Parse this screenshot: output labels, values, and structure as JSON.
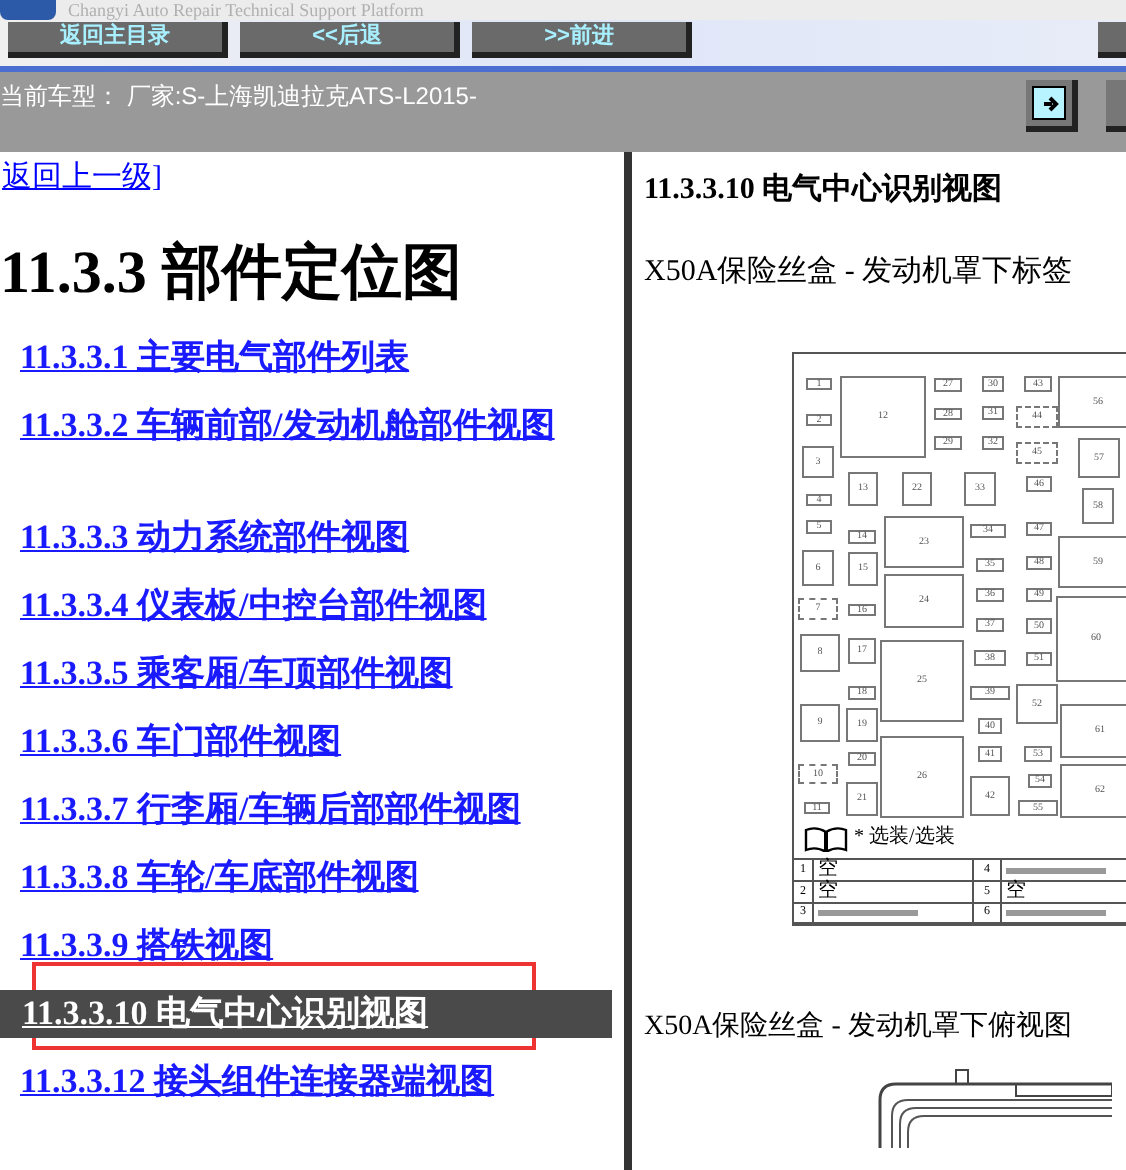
{
  "app_title": "Changyi Auto Repair Technical Support Platform",
  "toolbar": {
    "buttons": [
      "返回主目录",
      "<<后退",
      ">>前进"
    ]
  },
  "vehicle_bar": {
    "text": "当前车型：  厂家:S-上海凯迪拉克ATS-L2015-"
  },
  "nav": {
    "back_link": "返回上一级]",
    "heading": "11.3.3 部件定位图",
    "items": [
      {
        "label": "11.3.3.1 主要电气部件列表",
        "selected": false
      },
      {
        "label": "11.3.3.2 车辆前部/发动机舱部件视图",
        "selected": false
      },
      {
        "label": "11.3.3.3 动力系统部件视图",
        "selected": false
      },
      {
        "label": "11.3.3.4 仪表板/中控台部件视图",
        "selected": false
      },
      {
        "label": "11.3.3.5 乘客厢/车顶部件视图",
        "selected": false
      },
      {
        "label": "11.3.3.6 车门部件视图",
        "selected": false
      },
      {
        "label": "11.3.3.7 行李厢/车辆后部部件视图",
        "selected": false
      },
      {
        "label": "11.3.3.8 车轮/车底部件视图",
        "selected": false
      },
      {
        "label": "11.3.3.9 搭铁视图",
        "selected": false
      },
      {
        "label": "11.3.3.10 电气中心识别视图",
        "selected": true
      },
      {
        "label": "11.3.3.12 接头组件连接器端视图",
        "selected": false
      }
    ]
  },
  "content": {
    "title": "11.3.3.10 电气中心识别视图",
    "caption_1": "X50A保险丝盒 - 发动机罩下标签",
    "caption_2": "X50A保险丝盒 - 发动机罩下俯视图"
  },
  "fuse_diagram": {
    "fuses": [
      {
        "label": "1",
        "kind": "solid"
      },
      {
        "label": "2",
        "kind": "solid"
      },
      {
        "label": "3",
        "kind": "solid"
      },
      {
        "label": "4",
        "kind": "solid"
      },
      {
        "label": "5",
        "kind": "solid"
      },
      {
        "label": "6",
        "kind": "solid"
      },
      {
        "label": "7",
        "kind": "optional"
      },
      {
        "label": "8",
        "kind": "solid"
      },
      {
        "label": "9",
        "kind": "solid"
      },
      {
        "label": "10",
        "kind": "optional"
      },
      {
        "label": "11",
        "kind": "solid"
      },
      {
        "label": "12",
        "kind": "solid"
      },
      {
        "label": "13",
        "kind": "solid"
      },
      {
        "label": "14",
        "kind": "solid"
      },
      {
        "label": "15",
        "kind": "solid"
      },
      {
        "label": "16",
        "kind": "solid"
      },
      {
        "label": "17",
        "kind": "solid"
      },
      {
        "label": "18",
        "kind": "solid"
      },
      {
        "label": "19",
        "kind": "solid"
      },
      {
        "label": "20",
        "kind": "solid"
      },
      {
        "label": "21",
        "kind": "solid"
      },
      {
        "label": "22",
        "kind": "solid"
      },
      {
        "label": "23",
        "kind": "solid"
      },
      {
        "label": "24",
        "kind": "solid"
      },
      {
        "label": "25",
        "kind": "solid"
      },
      {
        "label": "26",
        "kind": "solid"
      },
      {
        "label": "27",
        "kind": "solid"
      },
      {
        "label": "28",
        "kind": "solid"
      },
      {
        "label": "29",
        "kind": "solid"
      },
      {
        "label": "30",
        "kind": "solid"
      },
      {
        "label": "31",
        "kind": "solid"
      },
      {
        "label": "32",
        "kind": "solid"
      },
      {
        "label": "33",
        "kind": "solid"
      },
      {
        "label": "34",
        "kind": "solid"
      },
      {
        "label": "35",
        "kind": "solid"
      },
      {
        "label": "36",
        "kind": "solid"
      },
      {
        "label": "37",
        "kind": "solid"
      },
      {
        "label": "38",
        "kind": "solid"
      },
      {
        "label": "39",
        "kind": "solid"
      },
      {
        "label": "40",
        "kind": "solid"
      },
      {
        "label": "41",
        "kind": "solid"
      },
      {
        "label": "42",
        "kind": "solid"
      },
      {
        "label": "43",
        "kind": "solid"
      },
      {
        "label": "44",
        "kind": "optional"
      },
      {
        "label": "45",
        "kind": "optional"
      },
      {
        "label": "46",
        "kind": "solid"
      },
      {
        "label": "47",
        "kind": "solid"
      },
      {
        "label": "48",
        "kind": "solid"
      },
      {
        "label": "49",
        "kind": "solid"
      },
      {
        "label": "50",
        "kind": "solid"
      },
      {
        "label": "51",
        "kind": "solid"
      },
      {
        "label": "52",
        "kind": "solid"
      },
      {
        "label": "53",
        "kind": "solid"
      },
      {
        "label": "54",
        "kind": "solid"
      },
      {
        "label": "55",
        "kind": "solid"
      },
      {
        "label": "56",
        "kind": "solid"
      },
      {
        "label": "57",
        "kind": "solid"
      },
      {
        "label": "58",
        "kind": "solid"
      },
      {
        "label": "59",
        "kind": "solid"
      },
      {
        "label": "60",
        "kind": "solid"
      },
      {
        "label": "61",
        "kind": "solid"
      },
      {
        "label": "62",
        "kind": "solid"
      }
    ],
    "legend": "* 选装/选装",
    "table": [
      {
        "number": "1",
        "description": "空"
      },
      {
        "number": "2",
        "description": "空"
      },
      {
        "number": "3"
      },
      {
        "number": "4"
      },
      {
        "number": "5",
        "description": "空"
      },
      {
        "number": "6"
      }
    ]
  }
}
